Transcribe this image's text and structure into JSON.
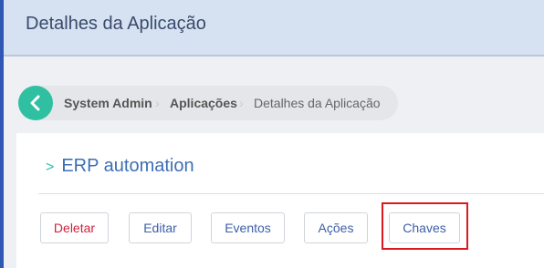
{
  "header": {
    "title": "Detalhes da Aplicação"
  },
  "breadcrumb": {
    "items": [
      "System Admin",
      "Aplicações",
      "Detalhes da Aplicação"
    ],
    "back_icon": "chevron-left-icon",
    "back_color": "#2fbfa1"
  },
  "app": {
    "name": "ERP automation"
  },
  "actions": {
    "delete_label": "Deletar",
    "edit_label": "Editar",
    "events_label": "Eventos",
    "actions_label": "Ações",
    "keys_label": "Chaves"
  },
  "colors": {
    "accent": "#3d6fb5",
    "danger": "#d0203f",
    "teal": "#2fbfa1",
    "highlight": "#d9191d"
  }
}
